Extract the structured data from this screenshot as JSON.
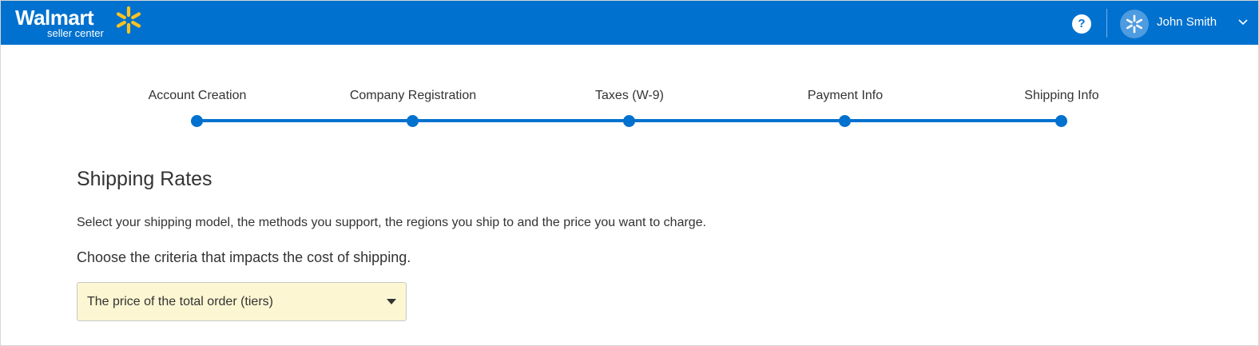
{
  "header": {
    "logo_text": "Walmart",
    "logo_subtext": "seller center",
    "help_label": "?",
    "user_name": "John Smith",
    "background_color": "#0071ce",
    "spark_color": "#ffc220"
  },
  "stepper": {
    "steps": [
      {
        "label": "Account Creation"
      },
      {
        "label": "Company Registration"
      },
      {
        "label": "Taxes (W-9)"
      },
      {
        "label": "Payment Info"
      },
      {
        "label": "Shipping Info"
      }
    ],
    "accent_color": "#0071ce"
  },
  "main": {
    "title": "Shipping Rates",
    "description": "Select your shipping model, the methods you support, the regions you ship to and the price you want to charge.",
    "criteria_label": "Choose the criteria that impacts the cost of shipping.",
    "criteria_select": {
      "selected": "The price of the total order (tiers)"
    }
  },
  "icons": {
    "logo_spark": "spark-icon",
    "help": "question-icon",
    "avatar": "spark-avatar-icon",
    "user_menu": "chevron-down-icon",
    "select": "caret-down-icon"
  }
}
